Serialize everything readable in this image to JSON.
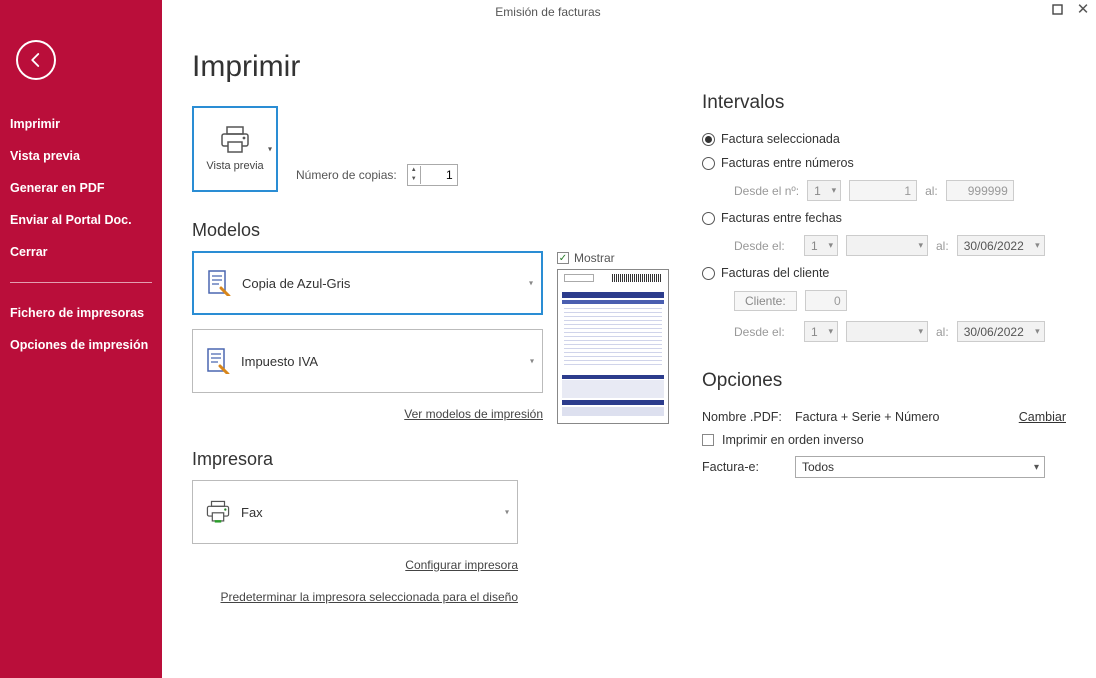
{
  "window": {
    "title": "Emisión de facturas"
  },
  "sidebar": {
    "items": [
      "Imprimir",
      "Vista previa",
      "Generar en PDF",
      "Enviar al Portal Doc.",
      "Cerrar"
    ],
    "items2": [
      "Fichero de impresoras",
      "Opciones de impresión"
    ]
  },
  "page": {
    "title": "Imprimir",
    "tile_label": "Vista previa",
    "copies_label": "Número de copias:",
    "copies_value": "1"
  },
  "modelos": {
    "heading": "Modelos",
    "show_label": "Mostrar",
    "model1": "Copia de Azul-Gris",
    "model2": "Impuesto IVA",
    "link": "Ver modelos de impresión"
  },
  "impresora": {
    "heading": "Impresora",
    "name": "Fax",
    "config_link": "Configurar impresora",
    "predet_link": "Predeterminar la impresora seleccionada para el diseño"
  },
  "intervalos": {
    "heading": "Intervalos",
    "r1": "Factura seleccionada",
    "r2": "Facturas entre números",
    "r2_from_lbl": "Desde el nº:",
    "r2_from_sel": "1",
    "r2_from_val": "1",
    "al": "al:",
    "r2_to_val": "999999",
    "r3": "Facturas entre fechas",
    "r3_from_lbl": "Desde el:",
    "r3_from_sel": "1",
    "r3_to_date": "30/06/2022",
    "r4": "Facturas del cliente",
    "r4_btn": "Cliente:",
    "r4_val": "0",
    "r4_from_lbl": "Desde el:",
    "r4_from_sel": "1",
    "r4_to_date": "30/06/2022"
  },
  "opciones": {
    "heading": "Opciones",
    "pdf_lbl": "Nombre .PDF:",
    "pdf_val": "Factura + Serie + Número",
    "change": "Cambiar",
    "reverse": "Imprimir en orden inverso",
    "facturae_lbl": "Factura-e:",
    "facturae_val": "Todos"
  }
}
